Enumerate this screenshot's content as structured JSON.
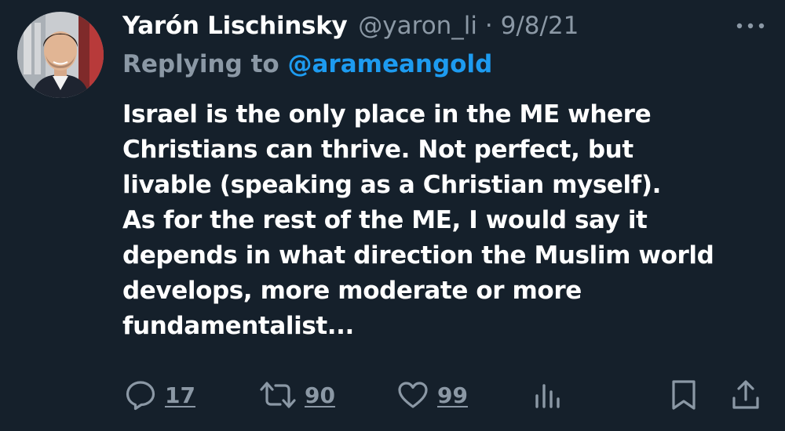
{
  "tweet": {
    "author": {
      "display_name": "Yarón Lischinsky",
      "handle": "@yaron_li"
    },
    "separator": "·",
    "date": "9/8/21",
    "reply": {
      "prefix": "Replying to ",
      "mention": "@arameangold"
    },
    "body_lines": [
      "Israel is the only place in the ME where",
      "Christians can thrive. Not perfect, but",
      "livable (speaking as a Christian myself).",
      "As for the rest of the ME, I would say it",
      "depends in what direction the Muslim world",
      "develops, more moderate or more",
      "fundamentalist..."
    ],
    "stats": {
      "replies": "17",
      "retweets": "90",
      "likes": "99"
    }
  },
  "icons": {
    "more": "more-dots-icon",
    "reply": "reply-icon",
    "retweet": "retweet-icon",
    "like": "heart-icon",
    "views": "views-chart-icon",
    "bookmark": "bookmark-icon",
    "share": "share-icon"
  },
  "colors": {
    "background": "#15202b",
    "text_primary": "#ffffff",
    "text_secondary": "#8b98a5",
    "accent": "#1d9bf0"
  }
}
